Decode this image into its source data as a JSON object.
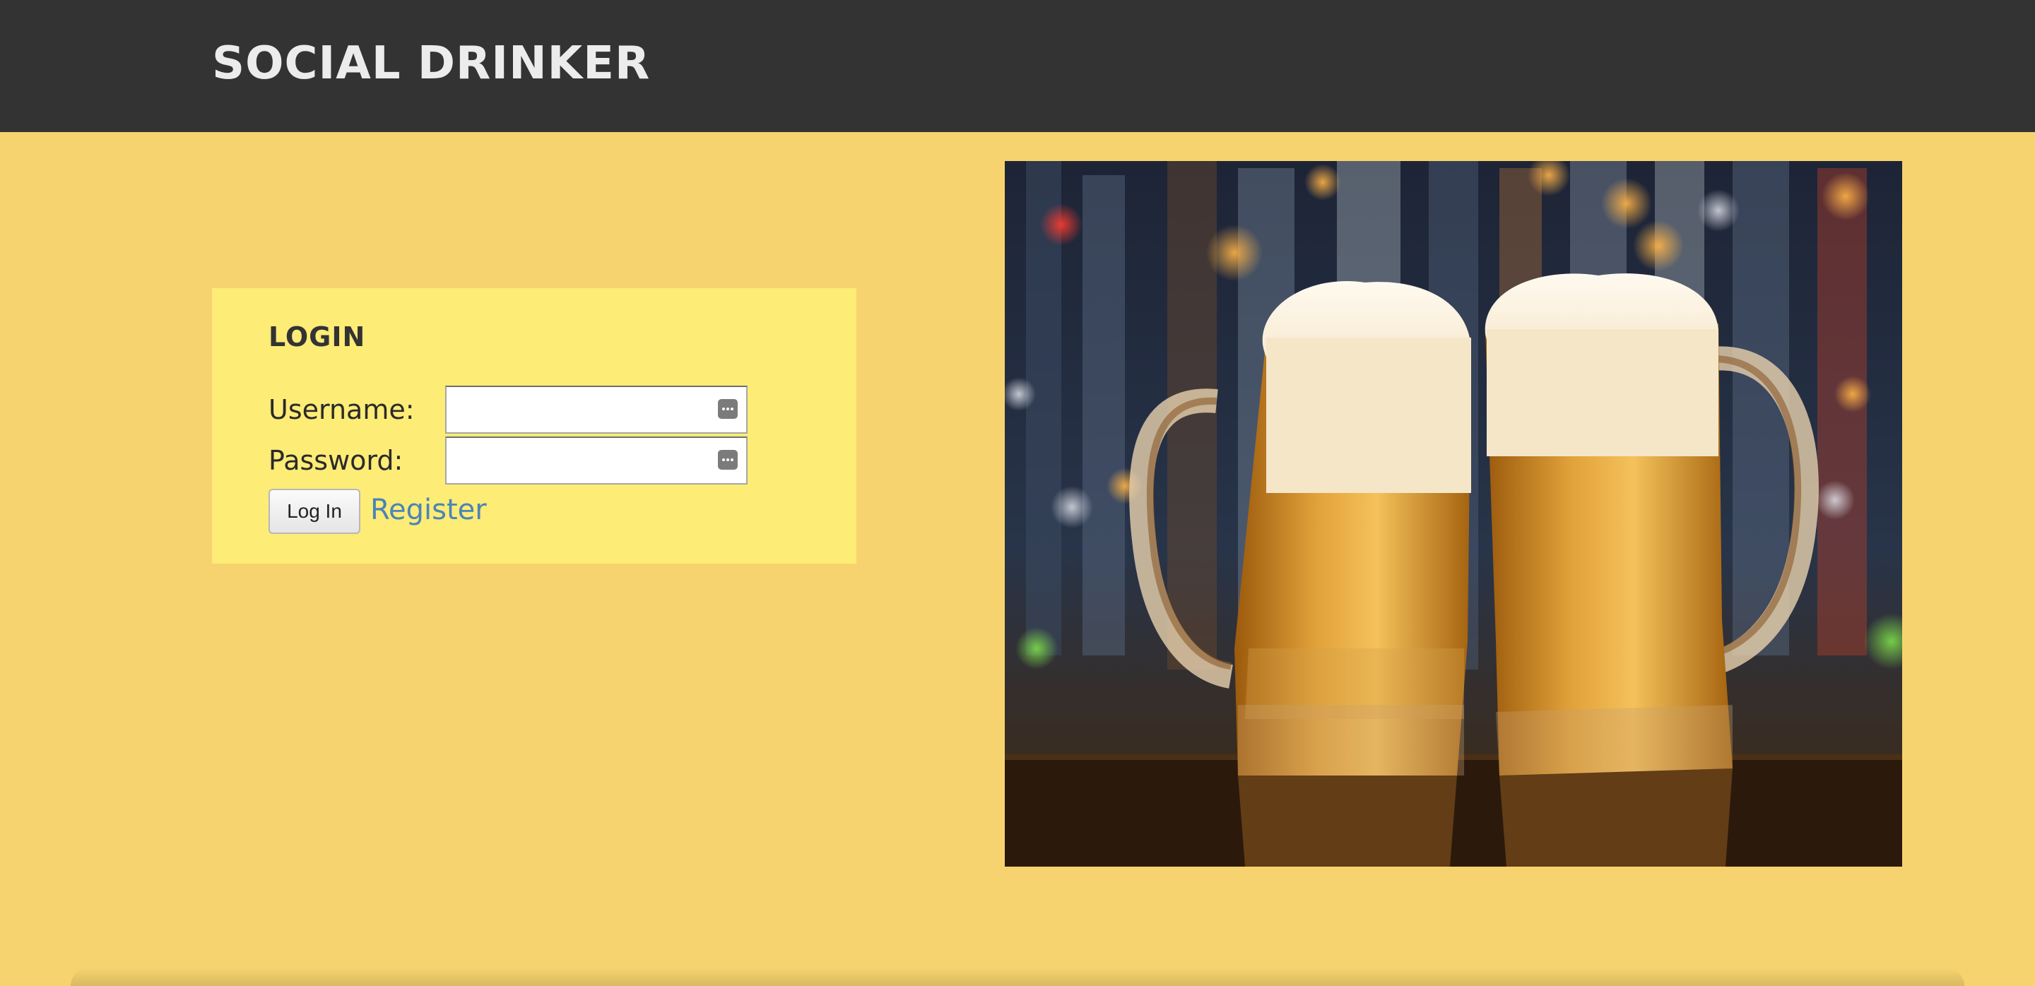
{
  "header": {
    "brand": "SOCIAL DRINKER"
  },
  "login": {
    "title": "LOGIN",
    "username_label": "Username:",
    "password_label": "Password:",
    "login_button": "Log In",
    "register_link": "Register",
    "username_value": "",
    "password_value": ""
  },
  "hero": {
    "icon": "beer-mugs-photo"
  },
  "colors": {
    "header_bg": "#333333",
    "page_bg": "#f7d36f",
    "panel_bg": "#fdec76",
    "link": "#4b84b6"
  }
}
